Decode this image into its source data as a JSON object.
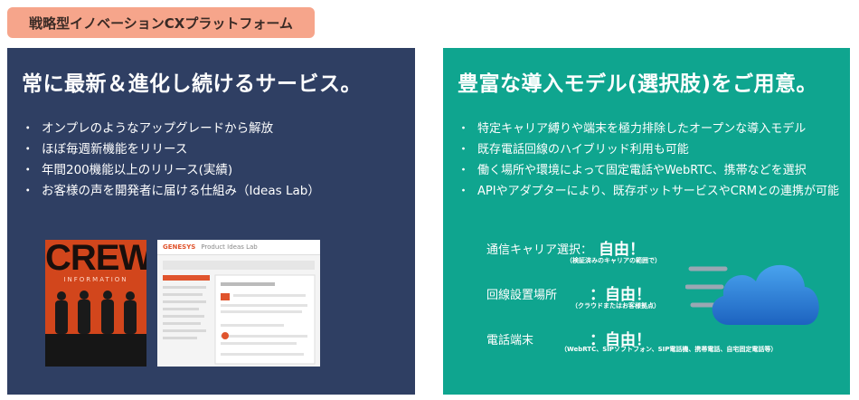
{
  "tag": {
    "label": "戦略型イノベーションCXプラットフォーム"
  },
  "left": {
    "title": "常に最新＆進化し続けるサービス。",
    "bullets": [
      "オンプレのようなアップグレードから解放",
      "ほぼ毎週新機能をリリース",
      "年間200機能以上のリリース(実績)",
      "お客様の声を開発者に届ける仕組み（Ideas Lab）"
    ],
    "bullet_mark": "・",
    "crew_word": "CREW",
    "crew_info": "INFORMATION",
    "genesys_brand": "GENESYS",
    "genesys_sub": "Product Ideas Lab"
  },
  "right": {
    "title": "豊富な導入モデル(選択肢)をご用意。",
    "bullets": [
      "特定キャリア縛りや端末を極力排除したオープンな導入モデル",
      "既存電話回線のハイブリッド利用も可能",
      "働く場所や環境によって固定電話やWebRTC、携帯などを選択",
      "APIやアダプターにより、既存ボットサービスやCRMとの連携が可能"
    ],
    "features": [
      {
        "label": "通信キャリア選択：",
        "value": "自由！",
        "note": "（検証済みのキャリアの範囲で）"
      },
      {
        "label": "回線設置場所",
        "value": "：自由！",
        "note": "（クラウドまたはお客様拠点）"
      },
      {
        "label": "電話端末",
        "value": "：自由！",
        "note": "（WebRTC、SIPソフトフォン、SIP電話機、携帯電話、自宅固定電話等）"
      }
    ]
  },
  "colors": {
    "tag_bg": "#f6a58b",
    "left_bg": "#2f3f63",
    "right_bg": "#0fa58f",
    "cloud": "#1f6fc9"
  }
}
